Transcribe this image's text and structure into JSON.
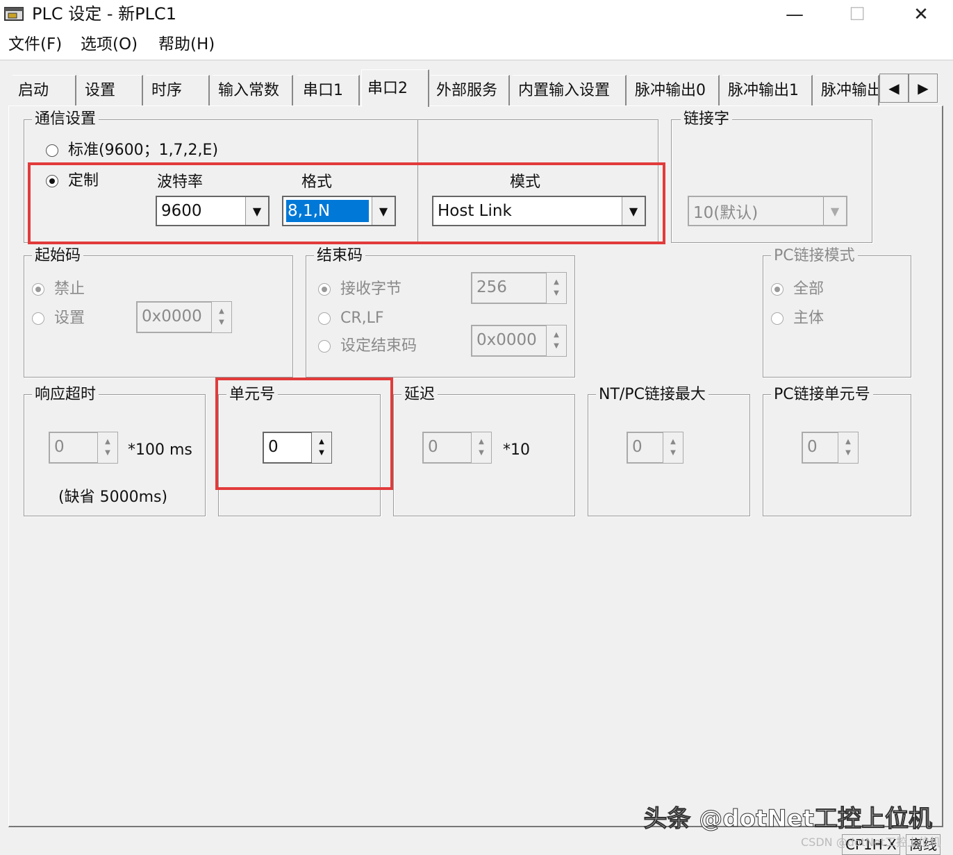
{
  "window": {
    "title": "PLC 设定 - 新PLC1",
    "minimize": "—",
    "maximize": "☐",
    "close": "✕"
  },
  "menu": [
    "文件(F)",
    "选项(O)",
    "帮助(H)"
  ],
  "tabs": [
    "启动",
    "设置",
    "时序",
    "输入常数",
    "串口1",
    "串口2",
    "外部服务",
    "内置输入设置",
    "脉冲输出0",
    "脉冲输出1",
    "脉冲输出"
  ],
  "active_tab": "串口2",
  "comm": {
    "title": "通信设置",
    "standard_label": "标准(9600；1,7,2,E)",
    "custom_label": "定制",
    "baud_label": "波特率",
    "baud_value": "9600",
    "format_label": "格式",
    "format_value": "8,1,N",
    "mode_label": "模式",
    "mode_value": "Host Link"
  },
  "link_word": {
    "title": "链接字",
    "value": "10(默认)"
  },
  "start_code": {
    "title": "起始码",
    "disable_label": "禁止",
    "set_label": "设置",
    "value": "0x0000"
  },
  "end_code": {
    "title": "结束码",
    "recv_bytes_label": "接收字节",
    "crlf_label": "CR,LF",
    "set_end_label": "设定结束码",
    "bytes_value": "256",
    "code_value": "0x0000"
  },
  "pc_link_mode": {
    "title": "PC链接模式",
    "all_label": "全部",
    "master_label": "主体"
  },
  "response_timeout": {
    "title": "响应超时",
    "value": "0",
    "unit": "*100 ms",
    "note": "(缺省 5000ms)"
  },
  "unit_no": {
    "title": "单元号",
    "value": "0"
  },
  "delay": {
    "title": "延迟",
    "value": "0",
    "unit": "*10"
  },
  "nt_pc_max": {
    "title": "NT/PC链接最大",
    "value": "0"
  },
  "pc_link_unit": {
    "title": "PC链接单元号",
    "value": "0"
  },
  "status": {
    "model": "CP1H-X",
    "state": "离线"
  },
  "watermark": "头条 @dotNet工控上位机",
  "csdn": "CSDN @dotNet工控上位机"
}
